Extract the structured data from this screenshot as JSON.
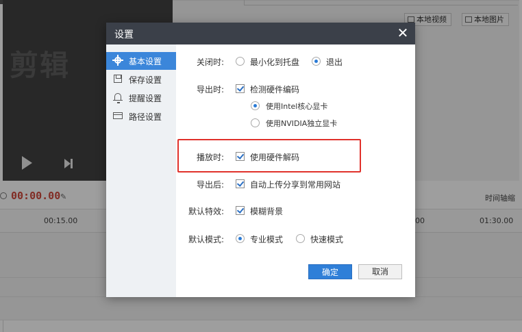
{
  "background": {
    "preview_watermark": "剪辑",
    "media_buttons": [
      "本地视频",
      "本地图片"
    ],
    "time_current": "00:00.00",
    "zoom_label": "时间轴缩",
    "ruler_ticks": [
      "00:15.00",
      "00",
      "01:30.00"
    ]
  },
  "dialog": {
    "title": "设置",
    "close_glyph": "✕",
    "sidebar": {
      "items": [
        {
          "label": "基本设置",
          "icon": "gear-icon",
          "active": true
        },
        {
          "label": "保存设置",
          "icon": "save-icon",
          "active": false
        },
        {
          "label": "提醒设置",
          "icon": "bell-icon",
          "active": false
        },
        {
          "label": "路径设置",
          "icon": "folder-icon",
          "active": false
        }
      ]
    },
    "settings": {
      "on_close": {
        "label": "关闭时:",
        "options": [
          {
            "label": "最小化到托盘",
            "selected": false
          },
          {
            "label": "退出",
            "selected": true
          }
        ]
      },
      "on_export": {
        "label": "导出时:",
        "checkbox": {
          "label": "检测硬件编码",
          "checked": true
        },
        "gpu_options": [
          {
            "label": "使用Intel核心显卡",
            "selected": true
          },
          {
            "label": "使用NVIDIA独立显卡",
            "selected": false
          }
        ]
      },
      "on_play": {
        "label": "播放时:",
        "checkbox": {
          "label": "使用硬件解码",
          "checked": true
        }
      },
      "after_export": {
        "label": "导出后:",
        "checkbox": {
          "label": "自动上传分享到常用网站",
          "checked": true
        }
      },
      "default_effect": {
        "label": "默认特效:",
        "checkbox": {
          "label": "模糊背景",
          "checked": true
        }
      },
      "default_mode": {
        "label": "默认模式:",
        "options": [
          {
            "label": "专业模式",
            "selected": true
          },
          {
            "label": "快速模式",
            "selected": false
          }
        ]
      }
    },
    "buttons": {
      "ok": "确定",
      "cancel": "取消"
    }
  },
  "colors": {
    "header": "#3b4049",
    "accent": "#2f7fd8",
    "highlight": "#e0302a",
    "time": "#d0483a"
  }
}
